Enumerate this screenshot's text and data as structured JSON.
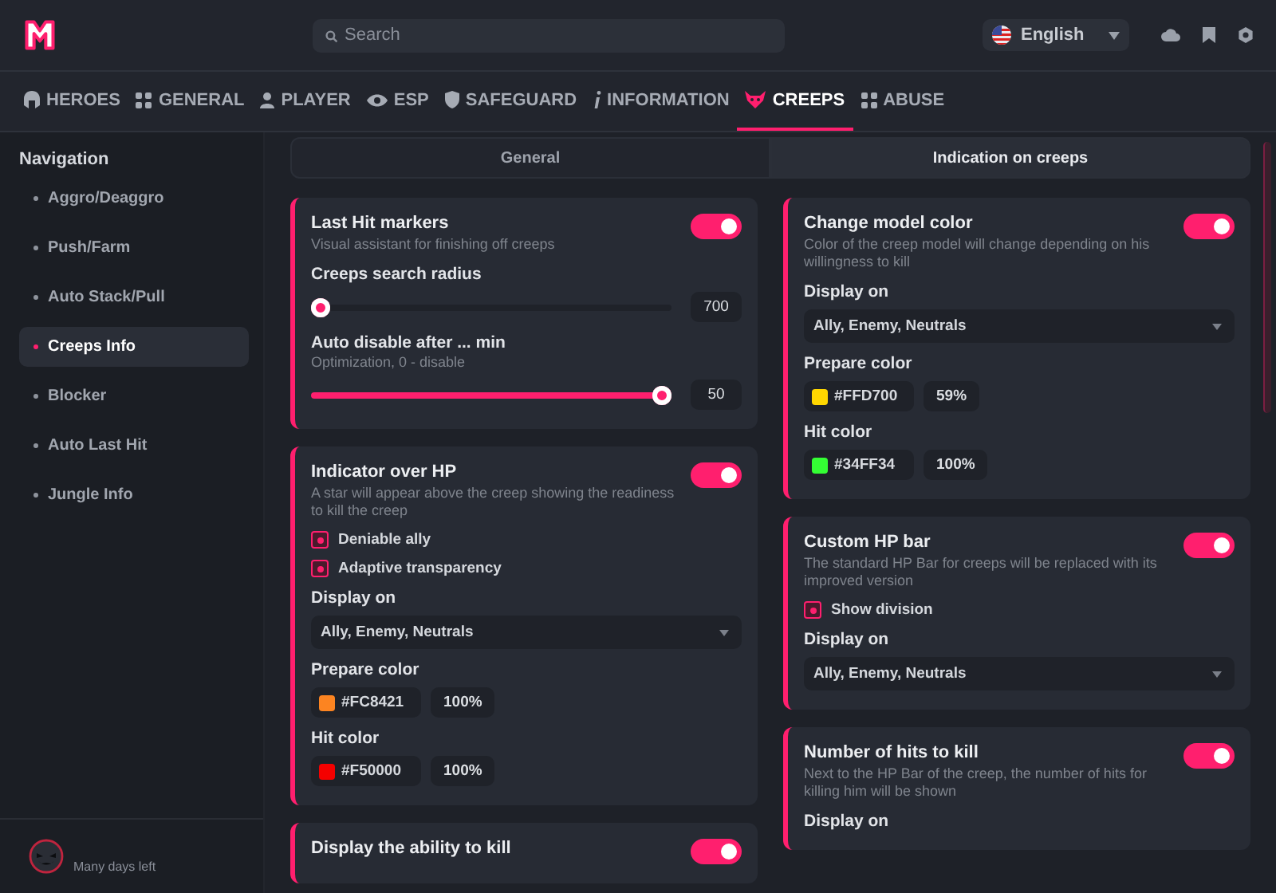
{
  "search": {
    "placeholder": "Search"
  },
  "language": {
    "value": "English"
  },
  "nav_tabs": [
    {
      "label": "HEROES",
      "selected": false
    },
    {
      "label": "GENERAL",
      "selected": false
    },
    {
      "label": "PLAYER",
      "selected": false
    },
    {
      "label": "ESP",
      "selected": false
    },
    {
      "label": "SAFEGUARD",
      "selected": false
    },
    {
      "label": "INFORMATION",
      "selected": false
    },
    {
      "label": "CREEPS",
      "selected": true
    },
    {
      "label": "ABUSE",
      "selected": false
    }
  ],
  "sidebar": {
    "title": "Navigation",
    "items": [
      {
        "label": "Aggro/Deaggro",
        "selected": false
      },
      {
        "label": "Push/Farm",
        "selected": false
      },
      {
        "label": "Auto Stack/Pull",
        "selected": false
      },
      {
        "label": "Creeps Info",
        "selected": true
      },
      {
        "label": "Blocker",
        "selected": false
      },
      {
        "label": "Auto Last Hit",
        "selected": false
      },
      {
        "label": "Jungle Info",
        "selected": false
      }
    ],
    "footer": {
      "status": "Many days left"
    }
  },
  "segments": [
    {
      "label": "General",
      "selected": false
    },
    {
      "label": "Indication on creeps",
      "selected": true
    }
  ],
  "columns": [
    {
      "cards": [
        {
          "title": "Last Hit markers",
          "description": "Visual assistant for finishing off creeps",
          "on": true,
          "controls": [
            {
              "kind": "slider",
              "label": "Creeps search radius",
              "level": 0.0,
              "value": "700"
            },
            {
              "kind": "slider",
              "label": "Auto disable after ... min",
              "hint": "Optimization,  0 - disable",
              "level": 1.0,
              "value": "50"
            }
          ]
        },
        {
          "title": "Indicator over HP",
          "description": "A star will appear above the creep showing the readiness to kill the creep",
          "on": true,
          "controls": [
            {
              "kind": "checkbox",
              "label": "Deniable ally",
              "checked": true
            },
            {
              "kind": "checkbox",
              "label": "Adaptive transparency",
              "checked": true
            },
            {
              "kind": "dropdown",
              "label": "Display on",
              "value": "Ally, Enemy, Neutrals"
            },
            {
              "kind": "color",
              "label": "Prepare color",
              "hex": "#FC8421",
              "color": "#fc8421",
              "opacity": "100%"
            },
            {
              "kind": "color",
              "label": "Hit color",
              "hex": "#F50000",
              "color": "#f50000",
              "opacity": "100%"
            }
          ]
        },
        {
          "title": "Display the ability to kill",
          "on": true
        }
      ]
    },
    {
      "cards": [
        {
          "title": "Change model color",
          "description": "Color of the creep model will change depending on his willingness to kill",
          "on": true,
          "controls": [
            {
              "kind": "dropdown",
              "label": "Display on",
              "value": "Ally, Enemy, Neutrals"
            },
            {
              "kind": "color",
              "label": "Prepare color",
              "hex": "#FFD700",
              "color": "#ffd700",
              "opacity": "59%"
            },
            {
              "kind": "color",
              "label": "Hit color",
              "hex": "#34FF34",
              "color": "#34ff34",
              "opacity": "100%"
            }
          ]
        },
        {
          "title": "Custom HP bar",
          "description": "The standard HP Bar for creeps will be replaced with its improved version",
          "on": true,
          "controls": [
            {
              "kind": "checkbox",
              "label": "Show division",
              "checked": true
            },
            {
              "kind": "dropdown",
              "label": "Display on",
              "value": "Ally, Enemy, Neutrals"
            }
          ]
        },
        {
          "title": "Number of hits to kill",
          "description": "Next to the HP Bar of the creep, the number of hits for killing him will be shown",
          "on": true,
          "controls": [
            {
              "kind": "label",
              "label": "Display on"
            }
          ]
        }
      ]
    }
  ]
}
